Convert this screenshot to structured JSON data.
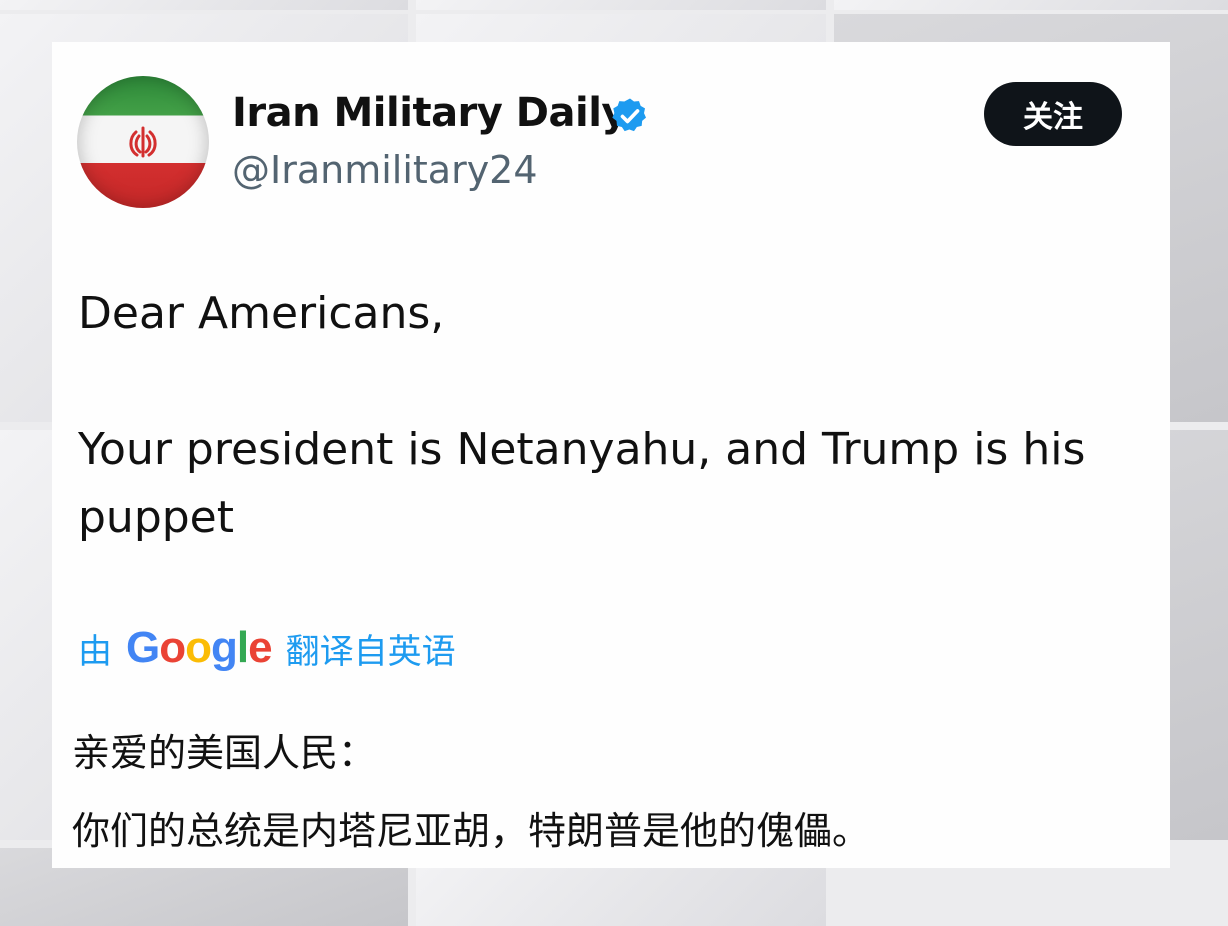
{
  "account": {
    "display_name": "Iran Military Daily",
    "handle": "@Iranmilitary24",
    "verified": true,
    "avatar_icon": "iran-flag-avatar"
  },
  "follow_button": {
    "label": "关注"
  },
  "tweet": {
    "lines": [
      "Dear Americans,",
      "Your president is Netanyahu, and Trump is his",
      "puppet"
    ]
  },
  "translation": {
    "prefix": "由",
    "google_letters": [
      "G",
      "o",
      "o",
      "g",
      "l",
      "e"
    ],
    "suffix": "翻译自英语",
    "lines": [
      "亲爱的美国人民：",
      "你们的总统是内塔尼亚胡，特朗普是他的傀儡。"
    ]
  },
  "colors": {
    "link_blue": "#1d9bf0",
    "google": [
      "#4285F4",
      "#EA4335",
      "#FBBC05",
      "#4285F4",
      "#34A853",
      "#EA4335"
    ],
    "button_bg": "#0f1419",
    "verified_blue": "#1d9bf0"
  }
}
